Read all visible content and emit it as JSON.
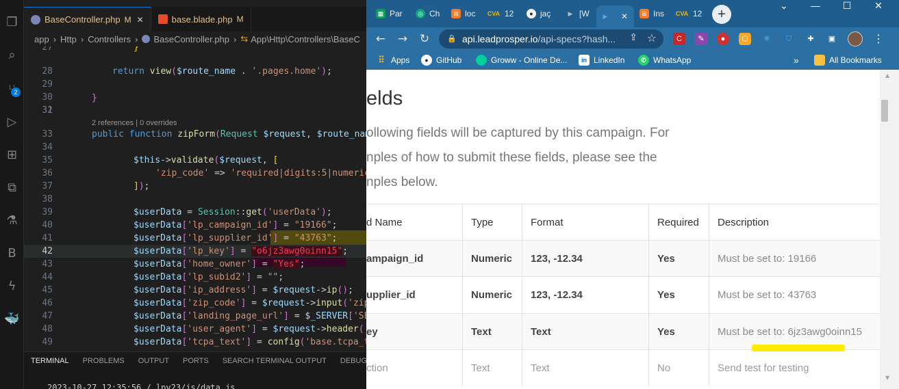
{
  "vscode": {
    "tabs": [
      {
        "label": "BaseController.php",
        "modified": "M",
        "close": "✕"
      },
      {
        "label": "base.blade.php",
        "modified": "M"
      }
    ],
    "breadcrumb": [
      "app",
      "Http",
      "Controllers",
      "BaseController.php",
      "App\\Http\\Controllers\\BaseC"
    ],
    "activity_badge": "2",
    "references_hint": "2 references | 0 overrides",
    "line_numbers": [
      "27",
      "28",
      "29",
      "30",
      "31",
      "32",
      "33",
      "34",
      "35",
      "36",
      "37",
      "38",
      "39",
      "40",
      "41",
      "42",
      "43",
      "44",
      "45",
      "46",
      "47",
      "48",
      "49"
    ],
    "panel_tabs": [
      "TERMINAL",
      "PROBLEMS",
      "OUTPUT",
      "PORTS",
      "SEARCH TERMINAL OUTPUT",
      "DEBUG C"
    ],
    "terminal_line": "2023-10-27 12:35:56 / lpv23/js/data.js"
  },
  "browser": {
    "tabs": [
      {
        "title": "Par",
        "color": "#0f9d58",
        "glyph": "▦"
      },
      {
        "title": "Ch",
        "color": "#10a37f",
        "glyph": "◎"
      },
      {
        "title": "loc",
        "color": "#fb7a24",
        "glyph": "⊞"
      },
      {
        "title": "12",
        "color": "#f4b400",
        "glyph": "CVA"
      },
      {
        "title": "jaç",
        "color": "#24292f",
        "glyph": "●"
      },
      {
        "title": "[W",
        "color": "#607d8b",
        "glyph": "▶"
      },
      {
        "title": "",
        "color": "#3b8cd6",
        "glyph": "▶"
      },
      {
        "title": "Ins",
        "color": "#fb7a24",
        "glyph": "⊞"
      },
      {
        "title": "12",
        "color": "#f4b400",
        "glyph": "CVA"
      }
    ],
    "active_tab_index": 6,
    "url_host": "api.leadprosper.io",
    "url_path": "/api-specs?hash...",
    "bookmarks": [
      "Apps",
      "GitHub",
      "Groww - Online De...",
      "LinkedIn",
      "WhatsApp"
    ],
    "more_bookmarks": "»",
    "all_bookmarks": "All Bookmarks"
  },
  "page": {
    "heading": "elds",
    "para_lines": [
      "ollowing fields will be captured by this campaign. For",
      "nples of how to submit these fields, please see the",
      "nples below."
    ],
    "table": {
      "headers": [
        "d Name",
        "Type",
        "Format",
        "Required",
        "Description"
      ],
      "rows": [
        [
          "ampaign_id",
          "Numeric",
          "123, -12.34",
          "Yes",
          "Must be set to: 19166"
        ],
        [
          "upplier_id",
          "Numeric",
          "123, -12.34",
          "Yes",
          "Must be set to: 43763"
        ],
        [
          "ey",
          "Text",
          "Text",
          "Yes",
          "Must be set to: 6jz3awg0oinn15"
        ],
        [
          "ction",
          "Text",
          "Text",
          "No",
          "Send test for testing"
        ]
      ]
    }
  },
  "colors": {
    "chrome_frame": "#1e5d8d",
    "chrome_toolbar": "#2b6fa3",
    "vscode_bg": "#1f1f1f",
    "highlight_yellow": "#ffeb00"
  }
}
